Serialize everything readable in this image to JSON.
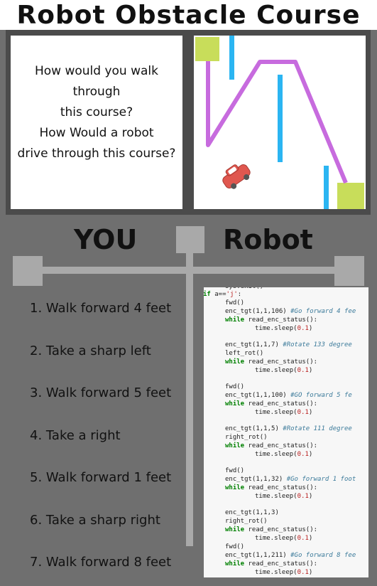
{
  "title": "Robot Obstacle Course",
  "question": "How would you walk\nthrough\nthis course?\nHow Would a robot\ndrive through this course?",
  "headings": {
    "you": "YOU",
    "robot": "Robot"
  },
  "steps": [
    "1. Walk forward 4 feet",
    "2. Take a sharp left",
    "3. Walk forward 5 feet",
    "4. Take a right",
    "5. Walk forward 1 feet",
    "6. Take a sharp right",
    "7. Walk forward 8 feet"
  ],
  "code": {
    "top_fragment": "sys.exit()",
    "if_line": "if a=='j':",
    "blocks": [
      {
        "lines": [
          {
            "t": "plain",
            "x": "fwd()"
          },
          {
            "t": "cmd",
            "x": "enc_tgt(1,1,106)",
            "c": "#Go forward 4 fee"
          },
          {
            "t": "while",
            "x": "read_enc_status():"
          },
          {
            "t": "sleep",
            "x": "time.sleep(0.1)"
          }
        ]
      },
      {
        "lines": [
          {
            "t": "cmd",
            "x": "enc_tgt(1,1,7)",
            "c": "#Rotate 133 degree"
          },
          {
            "t": "plain",
            "x": "left_rot()"
          },
          {
            "t": "while",
            "x": "read_enc_status():"
          },
          {
            "t": "sleep",
            "x": "time.sleep(0.1)"
          }
        ]
      },
      {
        "lines": [
          {
            "t": "plain",
            "x": "fwd()"
          },
          {
            "t": "cmd",
            "x": "enc_tgt(1,1,100)",
            "c": "#GO forward 5 fe"
          },
          {
            "t": "while",
            "x": "read_enc_status():"
          },
          {
            "t": "sleep",
            "x": "time.sleep(0.1)"
          }
        ]
      },
      {
        "lines": [
          {
            "t": "cmd",
            "x": "enc_tgt(1,1,5)",
            "c": "#Rotate 111 degree"
          },
          {
            "t": "plain",
            "x": "right_rot()"
          },
          {
            "t": "while",
            "x": "read_enc_status():"
          },
          {
            "t": "sleep",
            "x": "time.sleep(0.1)"
          }
        ]
      },
      {
        "lines": [
          {
            "t": "plain",
            "x": "fwd()"
          },
          {
            "t": "cmd",
            "x": "enc_tgt(1,1,32)",
            "c": "#Go forward 1 foot"
          },
          {
            "t": "while",
            "x": "read_enc_status():"
          },
          {
            "t": "sleep",
            "x": "time.sleep(0.1)"
          }
        ]
      },
      {
        "lines": [
          {
            "t": "plain",
            "x": "enc_tgt(1,1,3)"
          },
          {
            "t": "plain",
            "x": "right_rot()"
          },
          {
            "t": "while",
            "x": "read_enc_status():"
          },
          {
            "t": "sleep",
            "x": "time.sleep(0.1)"
          },
          {
            "t": "plain",
            "x": "fwd()"
          },
          {
            "t": "cmd",
            "x": "enc_tgt(1,1,211)",
            "c": "#Go forward 8 fee"
          },
          {
            "t": "while",
            "x": "read_enc_status():"
          },
          {
            "t": "sleep",
            "x": "time.sleep(0.1)"
          }
        ]
      }
    ]
  },
  "colors": {
    "background": "#6f6f6f",
    "path": "#c76bde",
    "obstacle": "#2bb5f2",
    "goal": "#c8dd5a",
    "car": "#e0574f"
  },
  "icons": {
    "car": "car-icon"
  }
}
